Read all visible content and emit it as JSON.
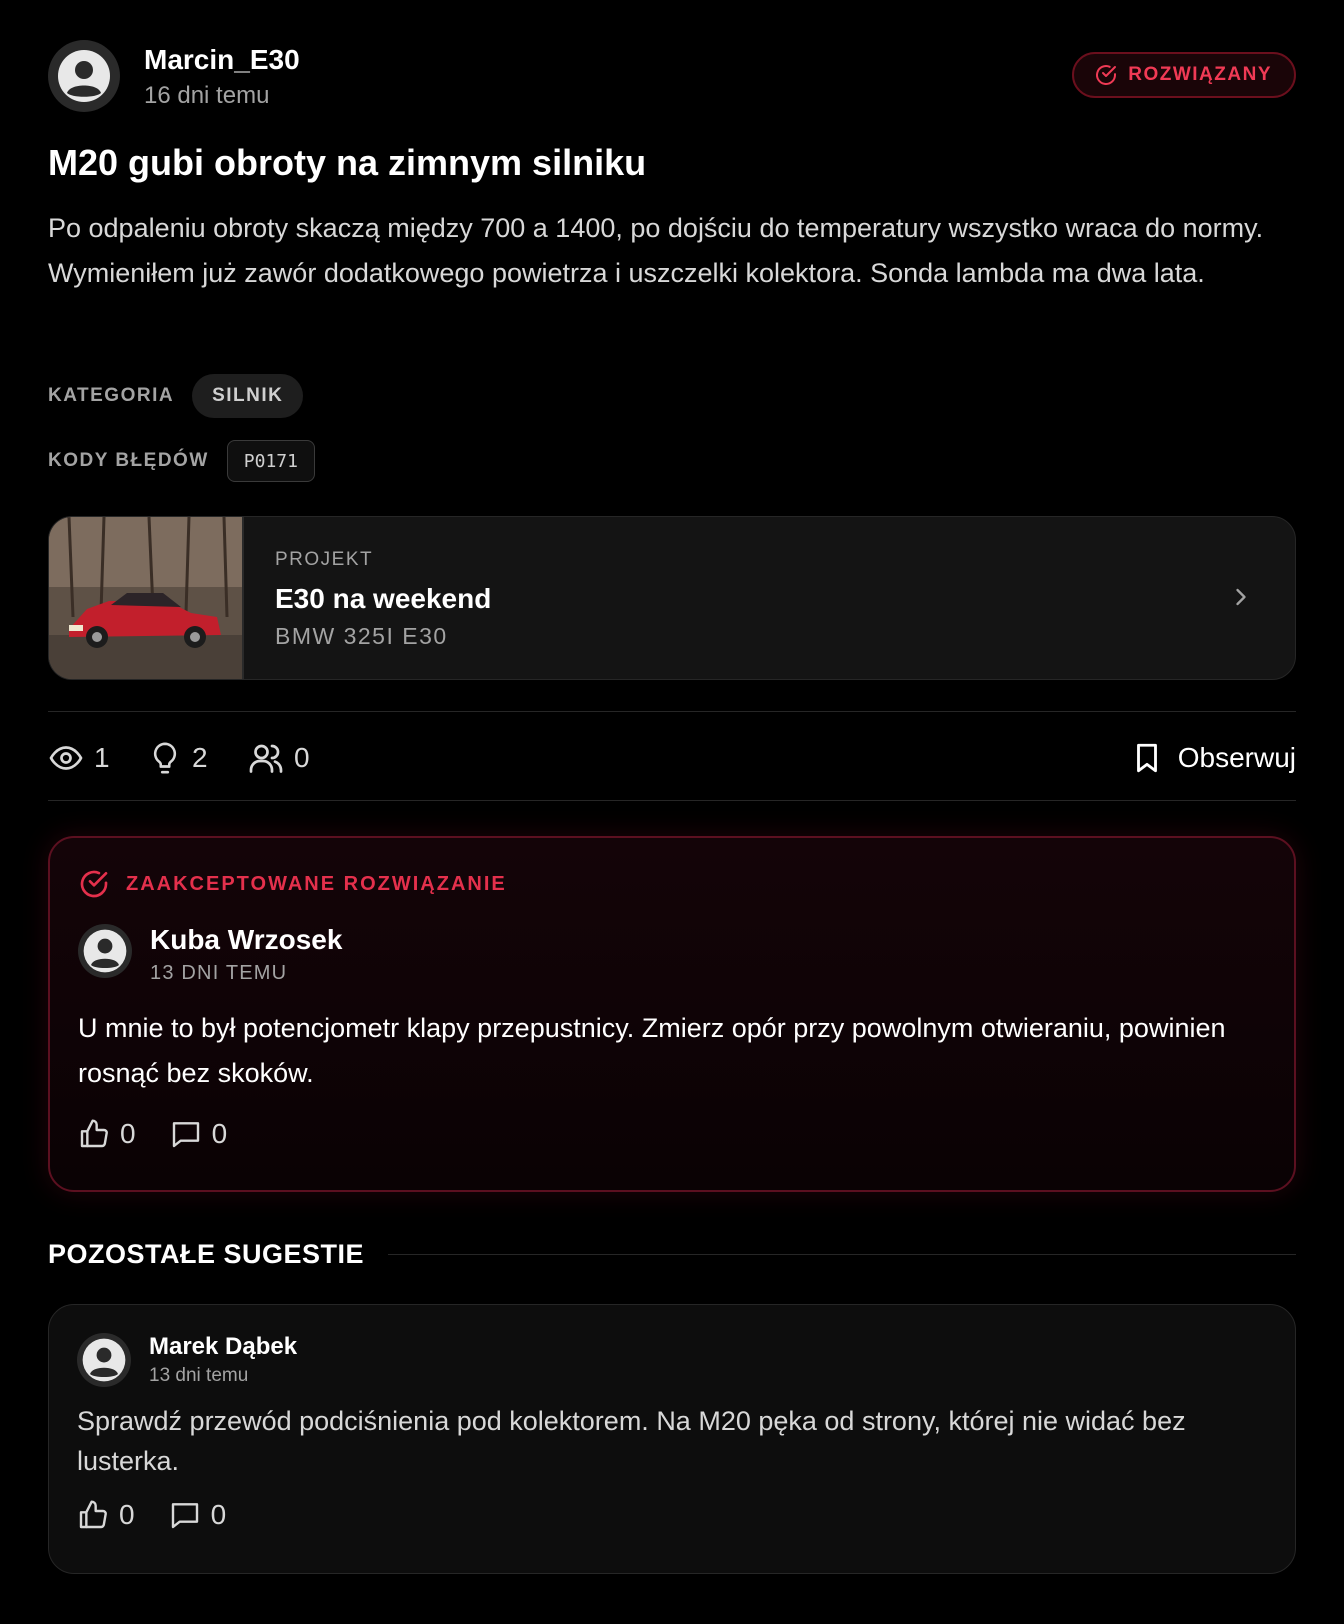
{
  "post": {
    "author": "Marcin_E30",
    "time": "16 dni temu",
    "status": "ROZWIĄZANY",
    "title": "M20 gubi obroty na zimnym silniku",
    "body": "Po odpaleniu obroty skaczą między 700 a 1400, po dojściu do temperatury wszystko wraca do normy. Wymieniłem już zawór dodatkowego powietrza i uszczelki kolektora. Sonda lambda ma dwa lata.",
    "category_label": "KATEGORIA",
    "category": "SILNIK",
    "codes_label": "KODY BŁĘDÓW",
    "codes": [
      "P0171"
    ]
  },
  "project": {
    "label": "PROJEKT",
    "name": "E30 na weekend",
    "car": "BMW 325I E30"
  },
  "stats": {
    "views": "1",
    "ideas": "2",
    "followers": "0",
    "follow_label": "Obserwuj"
  },
  "accepted": {
    "label": "ZAAKCEPTOWANE ROZWIĄZANIE",
    "author": "Kuba Wrzosek",
    "time": "13 DNI TEMU",
    "body": "U mnie to był potencjometr klapy przepustnicy. Zmierz opór przy powolnym otwieraniu, powinien rosnąć bez skoków.",
    "likes": "0",
    "replies": "0"
  },
  "others": {
    "title": "POZOSTAŁE SUGESTIE",
    "items": [
      {
        "author": "Marek Dąbek",
        "time": "13 dni temu",
        "body": "Sprawdź przewód podciśnienia pod kolektorem. Na M20 pęka od strony, której nie widać bez lusterka.",
        "likes": "0",
        "replies": "0"
      }
    ]
  },
  "colors": {
    "background": "#000000",
    "accent": "#e4304c",
    "muted": "#a3a3a3",
    "card": "#141414"
  }
}
